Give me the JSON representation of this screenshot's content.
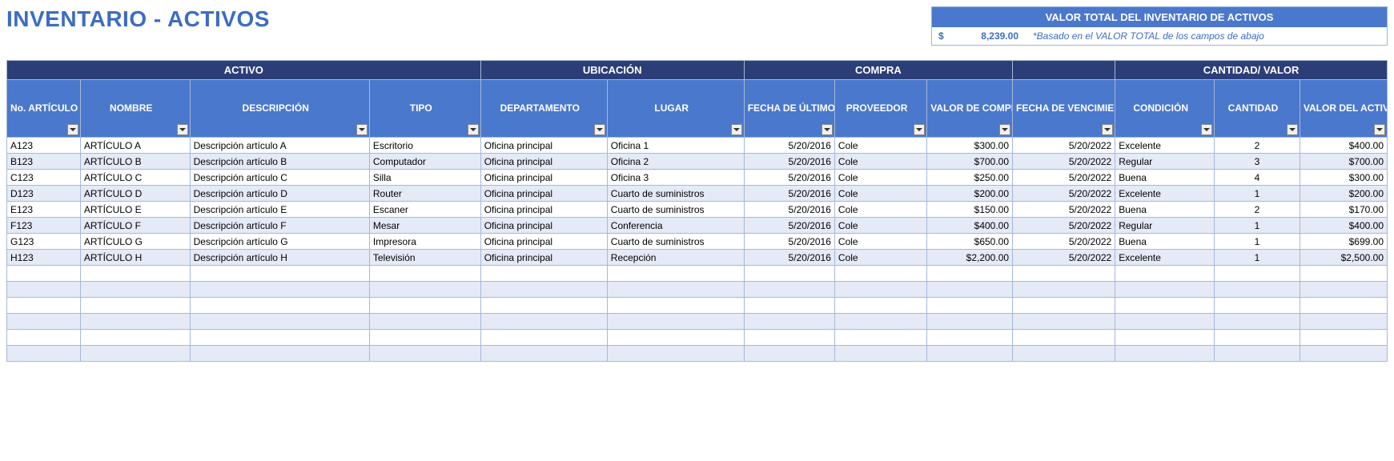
{
  "title": "INVENTARIO - ACTIVOS",
  "total": {
    "header": "VALOR TOTAL DEL INVENTARIO DE ACTIVOS",
    "currency": "$",
    "amount": "8,239.00",
    "note": "*Basado en el VALOR TOTAL de los campos de abajo"
  },
  "groups": {
    "g0": "ACTIVO",
    "g1": "UBICACIÓN",
    "g2": "COMPRA",
    "g3": "",
    "g4": "CANTIDAD/ VALOR"
  },
  "cols": {
    "c0": "No. ARTÍCULO",
    "c1": "NOMBRE",
    "c2": "DESCRIPCIÓN",
    "c3": "TIPO",
    "c4": "DEPARTAMENTO",
    "c5": "LUGAR",
    "c6": "FECHA DE ÚLTIMO PEDIDO",
    "c7": "PROVEEDOR",
    "c8": "VALOR DE COMPRA POR ARTÍCULO",
    "c9": "FECHA DE VENCIMIENTO DE LA GARANTÍA",
    "c10": "CONDICIÓN",
    "c11": "CANTIDAD",
    "c12": "VALOR DEL ACTIVO"
  },
  "rows": [
    {
      "id": "A123",
      "name": "ARTÍCULO A",
      "desc": "Descripción artículo A",
      "type": "Escritorio",
      "dept": "Oficina principal",
      "loc": "Oficina 1",
      "date": "5/20/2016",
      "prov": "Cole",
      "price": "$300.00",
      "warr": "5/20/2022",
      "cond": "Excelente",
      "qty": "2",
      "val": "$400.00"
    },
    {
      "id": "B123",
      "name": "ARTÍCULO B",
      "desc": "Descripción artículo B",
      "type": "Computador",
      "dept": "Oficina principal",
      "loc": "Oficina 2",
      "date": "5/20/2016",
      "prov": "Cole",
      "price": "$700.00",
      "warr": "5/20/2022",
      "cond": "Regular",
      "qty": "3",
      "val": "$700.00"
    },
    {
      "id": "C123",
      "name": "ARTÍCULO C",
      "desc": "Descripción artículo C",
      "type": "Silla",
      "dept": "Oficina principal",
      "loc": "Oficina 3",
      "date": "5/20/2016",
      "prov": "Cole",
      "price": "$250.00",
      "warr": "5/20/2022",
      "cond": "Buena",
      "qty": "4",
      "val": "$300.00"
    },
    {
      "id": "D123",
      "name": "ARTÍCULO D",
      "desc": "Descripción artículo D",
      "type": "Router",
      "dept": "Oficina principal",
      "loc": "Cuarto de suministros",
      "date": "5/20/2016",
      "prov": "Cole",
      "price": "$200.00",
      "warr": "5/20/2022",
      "cond": "Excelente",
      "qty": "1",
      "val": "$200.00"
    },
    {
      "id": "E123",
      "name": "ARTÍCULO E",
      "desc": "Descripción artículo E",
      "type": "Escaner",
      "dept": "Oficina principal",
      "loc": "Cuarto de suministros",
      "date": "5/20/2016",
      "prov": "Cole",
      "price": "$150.00",
      "warr": "5/20/2022",
      "cond": "Buena",
      "qty": "2",
      "val": "$170.00"
    },
    {
      "id": "F123",
      "name": "ARTÍCULO F",
      "desc": "Descripción artículo F",
      "type": "Mesar",
      "dept": "Oficina principal",
      "loc": "Conferencia",
      "date": "5/20/2016",
      "prov": "Cole",
      "price": "$400.00",
      "warr": "5/20/2022",
      "cond": "Regular",
      "qty": "1",
      "val": "$400.00"
    },
    {
      "id": "G123",
      "name": "ARTÍCULO G",
      "desc": "Descripción artículo G",
      "type": "Impresora",
      "dept": "Oficina principal",
      "loc": "Cuarto de suministros",
      "date": "5/20/2016",
      "prov": "Cole",
      "price": "$650.00",
      "warr": "5/20/2022",
      "cond": "Buena",
      "qty": "1",
      "val": "$699.00"
    },
    {
      "id": "H123",
      "name": "ARTÍCULO H",
      "desc": "Descripción artículo H",
      "type": "Televisión",
      "dept": "Oficina principal",
      "loc": "Recepción",
      "date": "5/20/2016",
      "prov": "Cole",
      "price": "$2,200.00",
      "warr": "5/20/2022",
      "cond": "Excelente",
      "qty": "1",
      "val": "$2,500.00"
    }
  ],
  "emptyRows": 6
}
